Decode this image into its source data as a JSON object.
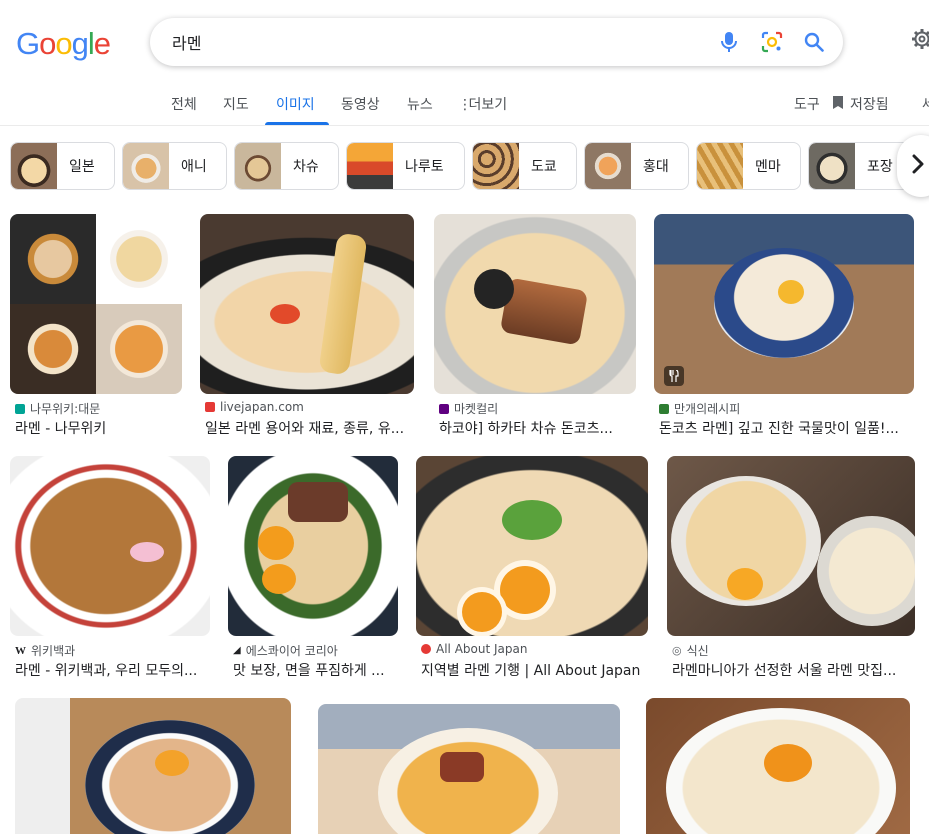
{
  "query": "라멘",
  "logo": {
    "letters": [
      "G",
      "o",
      "o",
      "g",
      "l",
      "e"
    ],
    "colors": [
      "#4285f4",
      "#ea4335",
      "#fbbc05",
      "#4285f4",
      "#34a853",
      "#ea4335"
    ]
  },
  "icons": {
    "mic": "mic-icon",
    "lens": "lens-icon",
    "search": "search-icon",
    "settings": "gear-icon",
    "more": "more-vert-icon",
    "bookmark": "bookmark-icon",
    "next": "chevron-right-icon"
  },
  "tabs": [
    {
      "label": "전체"
    },
    {
      "label": "지도"
    },
    {
      "label": "이미지",
      "active": true
    },
    {
      "label": "동영상"
    },
    {
      "label": "뉴스"
    },
    {
      "label": "더보기"
    }
  ],
  "tools": {
    "label": "도구",
    "saved_label": "저장됨",
    "partial": "세"
  },
  "chips": [
    "일본",
    "애니",
    "차슈",
    "나루토",
    "도쿄",
    "홍대",
    "멘마",
    "포장"
  ],
  "results": [
    {
      "source": "나무위키:대문",
      "title": "라멘 - 나무위키",
      "fav_color": "#00a495"
    },
    {
      "source": "livejapan.com",
      "title": "일본 라멘 용어와 재료, 종류, 유...",
      "fav_color": "#e53935"
    },
    {
      "source": "마켓컬리",
      "title": "하코야] 하카타 차슈 돈코츠...",
      "fav_color": "#5f0080"
    },
    {
      "source": "만개의레시피",
      "title": "돈코츠 라멘] 깊고 진한 국물맛이 일품!...",
      "fav_color": "#2e7d32"
    },
    {
      "source": "위키백과",
      "title": "라멘 - 위키백과, 우리 모두의...",
      "fav_color": "#ffffff"
    },
    {
      "source": "에스콰이어 코리아",
      "title": "맛 보장, 면을 푸짐하게 ...",
      "fav_color": "#ffffff"
    },
    {
      "source": "All About Japan",
      "title": "지역별 라멘 기행 | All About Japan",
      "fav_color": "#e53935"
    },
    {
      "source": "식신",
      "title": "라멘마니아가 선정한 서울 라멘 맛집...",
      "fav_color": "#ffffff"
    }
  ]
}
